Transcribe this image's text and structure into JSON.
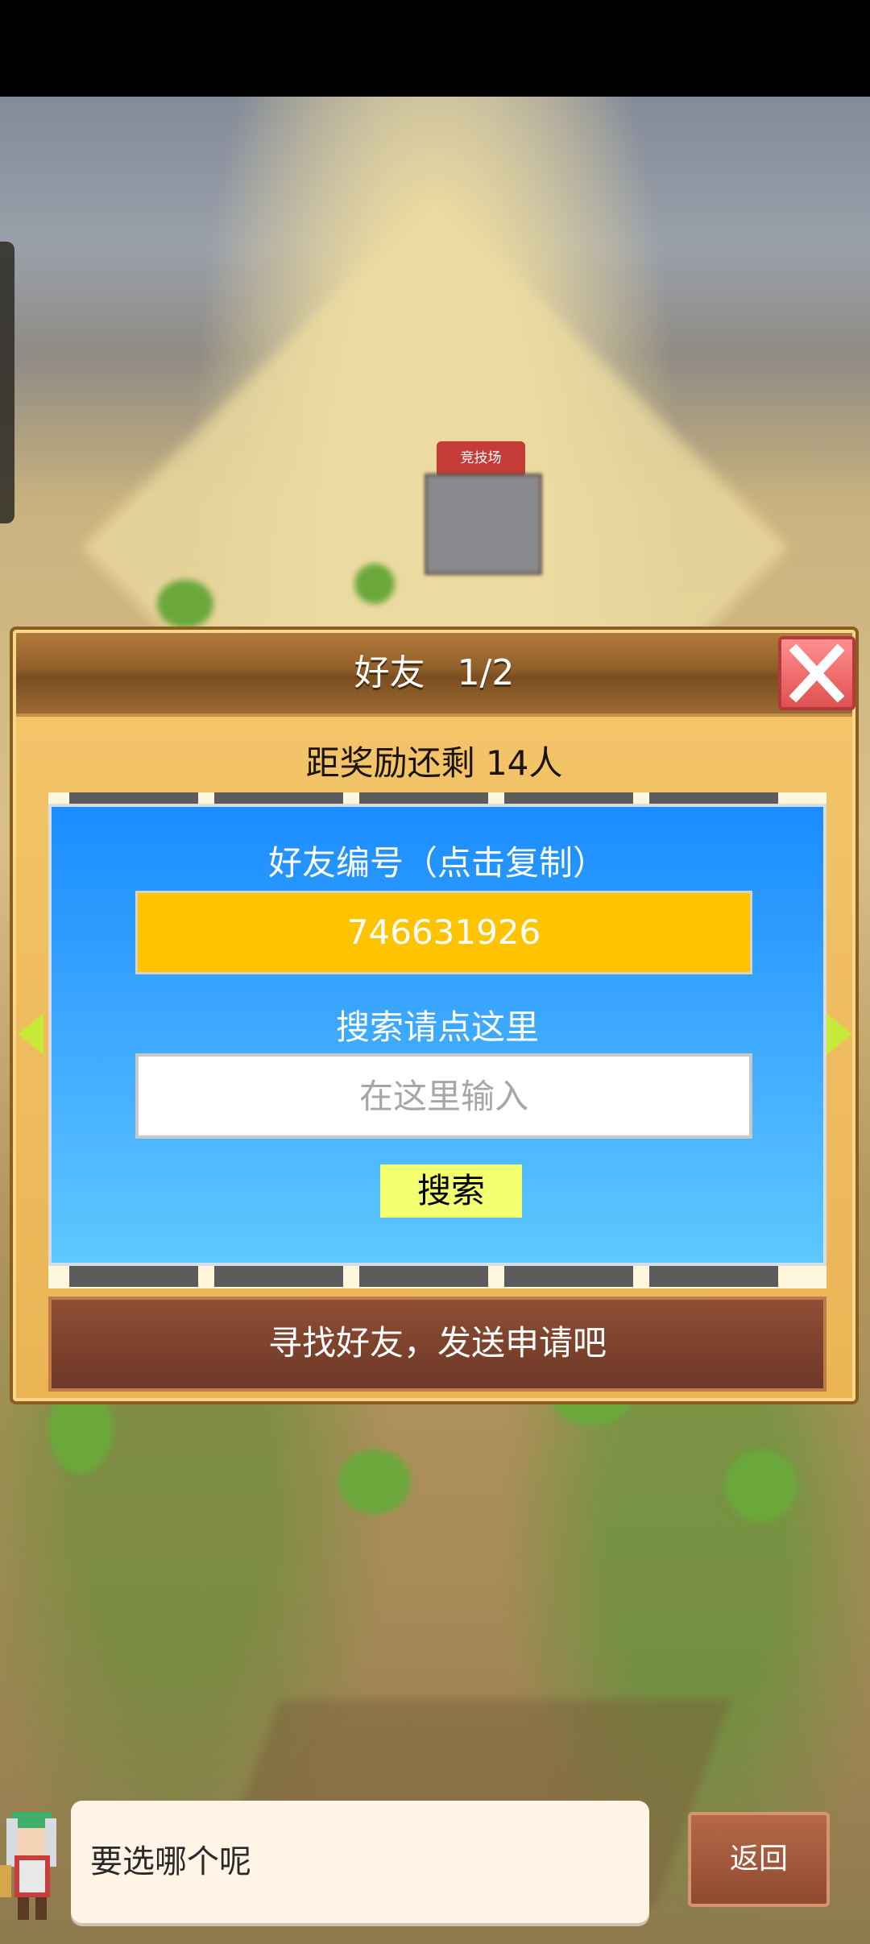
{
  "scene": {
    "building_sign": "竞技场"
  },
  "friend_panel": {
    "title": "好友",
    "page": "1/2",
    "remaining_text": "距奖励还剩 14人",
    "friend_id_label": "好友编号（点击复制）",
    "friend_id": "746631926",
    "search_label": "搜索请点这里",
    "search_placeholder": "在这里输入",
    "search_button": "搜索",
    "find_friends_banner": "寻找好友，发送申请吧"
  },
  "dialog": {
    "message": "要选哪个呢",
    "back_button": "返回"
  },
  "colors": {
    "panel_gold": "#eab454",
    "blue_box": "#1a8cff",
    "id_box": "#ffc300",
    "search_button": "#f2ff6e",
    "close_red": "#e05050"
  }
}
